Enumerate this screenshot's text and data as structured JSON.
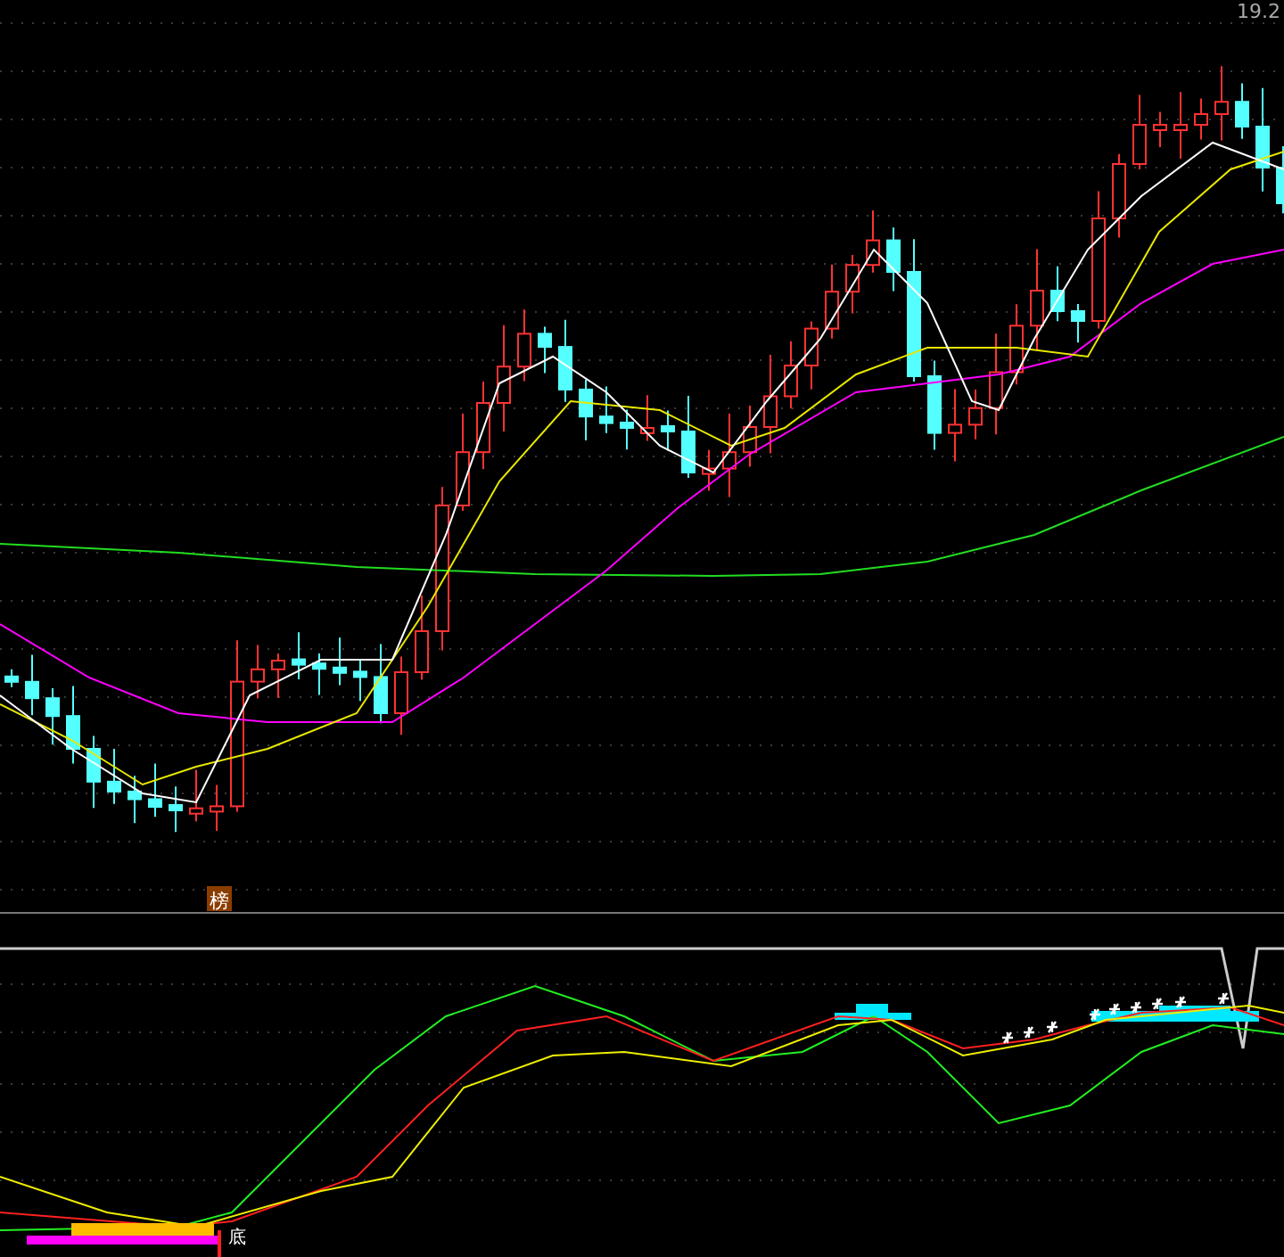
{
  "price_chart": {
    "high_label": "19.2",
    "marker_label": "榜"
  },
  "indicator_chart": {
    "signal_label": "底"
  }
}
